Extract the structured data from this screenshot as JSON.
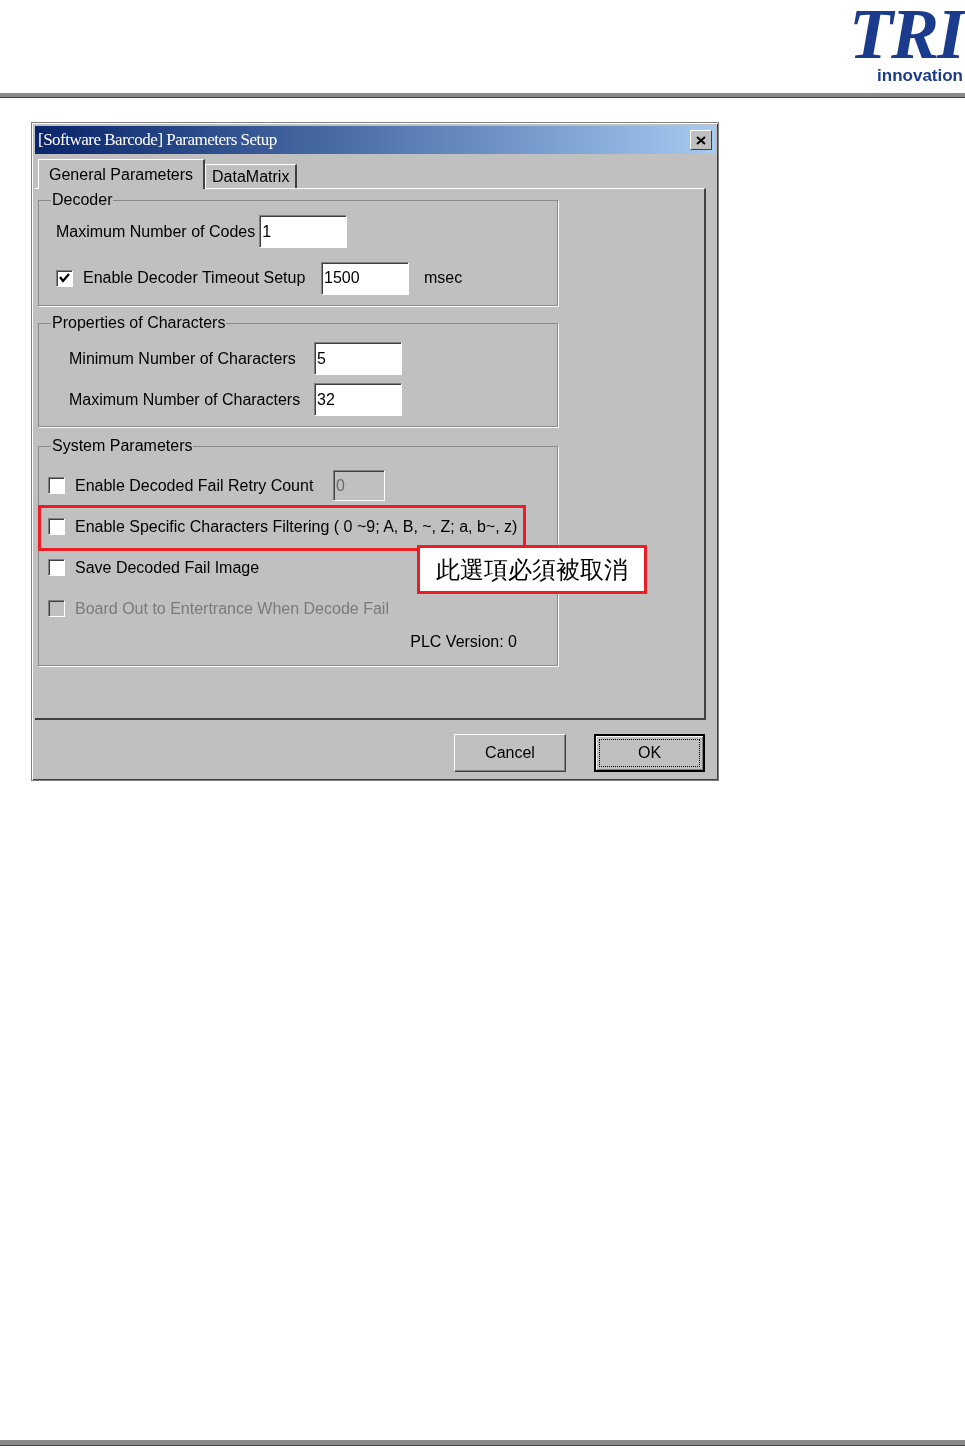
{
  "header": {
    "logo": {
      "mark": "TRI",
      "tagline": "innovation"
    }
  },
  "dialog": {
    "title": "[Software Barcode] Parameters Setup",
    "tabs": [
      {
        "label": "General Parameters",
        "selected": true
      },
      {
        "label": "DataMatrix",
        "selected": false
      }
    ],
    "groups": [
      {
        "title": "Decoder",
        "rows": [
          {
            "kind": "field",
            "label": "Maximum Number of Codes",
            "field": {
              "value": "1",
              "disabled": false
            }
          },
          {
            "kind": "checkbox_field",
            "label": "Enable Decoder Timeout Setup",
            "checked": true,
            "disabled": false,
            "field": {
              "value": "1500",
              "disabled": false
            },
            "unit": "msec"
          }
        ]
      },
      {
        "title": "Properties of Characters",
        "rows": [
          {
            "kind": "field",
            "label": "Minimum Number of Characters",
            "field": {
              "value": "5",
              "disabled": false
            }
          },
          {
            "kind": "field",
            "label": "Maximum Number of Characters",
            "field": {
              "value": "32",
              "disabled": false
            }
          }
        ]
      },
      {
        "title": "System Parameters",
        "rows": [
          {
            "kind": "checkbox_field",
            "label": "Enable Decoded Fail Retry Count",
            "checked": false,
            "disabled": false,
            "field": {
              "value": "0",
              "disabled": true
            }
          },
          {
            "kind": "checkbox",
            "label": "Enable Specific Characters Filtering ( 0 ~9; A, B, ~, Z; a, b~, z)",
            "checked": false,
            "disabled": false,
            "callout": "此選項必須被取消"
          },
          {
            "kind": "checkbox",
            "label": "Save Decoded Fail Image",
            "checked": false,
            "disabled": false
          },
          {
            "kind": "checkbox",
            "label": "Board Out to Entertrance When Decode Fail",
            "checked": false,
            "disabled": true
          }
        ],
        "footer": "PLC Version: 0"
      }
    ],
    "buttons": [
      {
        "label": "Cancel",
        "default": false
      },
      {
        "label": "OK",
        "default": true
      }
    ]
  }
}
